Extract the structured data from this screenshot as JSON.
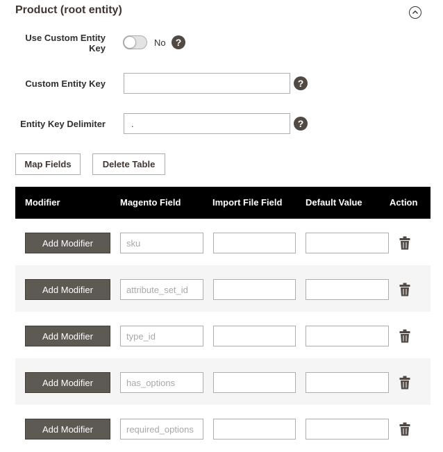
{
  "section": {
    "title": "Product (root entity)"
  },
  "fields": {
    "use_custom_key": {
      "label": "Use Custom Entity Key",
      "value_text": "No",
      "checked": false
    },
    "custom_key": {
      "label": "Custom Entity Key",
      "value": ""
    },
    "delimiter": {
      "label": "Entity Key Delimiter",
      "value": "."
    },
    "help_glyph": "?"
  },
  "buttons": {
    "map_fields": "Map Fields",
    "delete_table": "Delete Table"
  },
  "grid": {
    "columns": [
      "Modifier",
      "Magento Field",
      "Import File Field",
      "Default Value",
      "Action"
    ],
    "add_modifier_label": "Add Modifier",
    "rows": [
      {
        "magento_field": "sku",
        "import_field": "",
        "default_value": ""
      },
      {
        "magento_field": "attribute_set_id",
        "import_field": "",
        "default_value": ""
      },
      {
        "magento_field": "type_id",
        "import_field": "",
        "default_value": ""
      },
      {
        "magento_field": "has_options",
        "import_field": "",
        "default_value": ""
      },
      {
        "magento_field": "required_options",
        "import_field": "",
        "default_value": ""
      }
    ]
  },
  "icons": {
    "collapse": "chevron-up-circle-icon",
    "help": "question-circle-icon",
    "delete": "trash-icon"
  },
  "colors": {
    "header_bg": "#000000",
    "modifier_button_bg": "#5d5953",
    "help_icon_bg": "#514943",
    "alt_row_bg": "#f5f5f5"
  }
}
